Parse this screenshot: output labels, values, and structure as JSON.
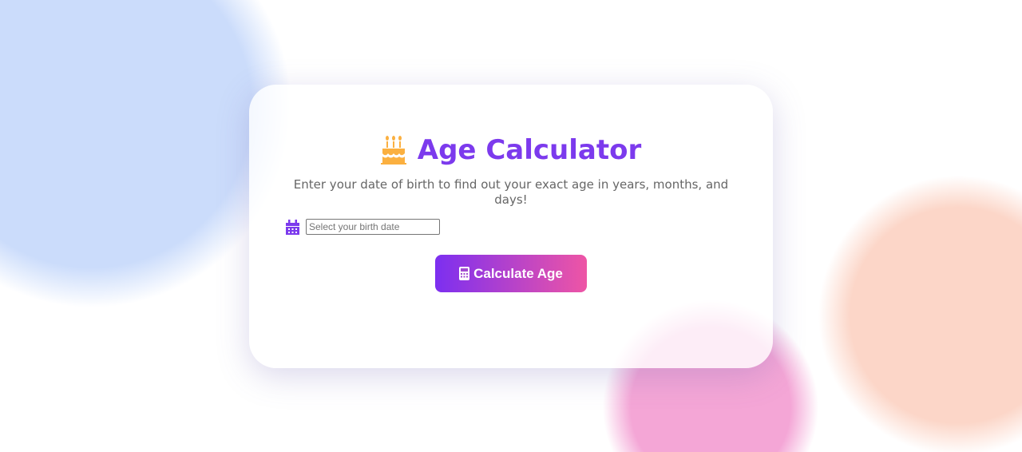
{
  "header": {
    "title": "Age Calculator",
    "subtitle": "Enter your date of birth to find out your exact age in years, months, and days!"
  },
  "form": {
    "birthdate_placeholder": "Select your birth date",
    "birthdate_value": "",
    "calculate_label": "Calculate Age"
  },
  "colors": {
    "accent": "#7c3aed",
    "cake": "#fbb040",
    "button_gradient_start": "#7c2ff0",
    "button_gradient_end": "#ee55a5"
  },
  "icons": {
    "title": "birthday-cake-icon",
    "input": "calendar-icon",
    "button": "calculator-icon"
  }
}
